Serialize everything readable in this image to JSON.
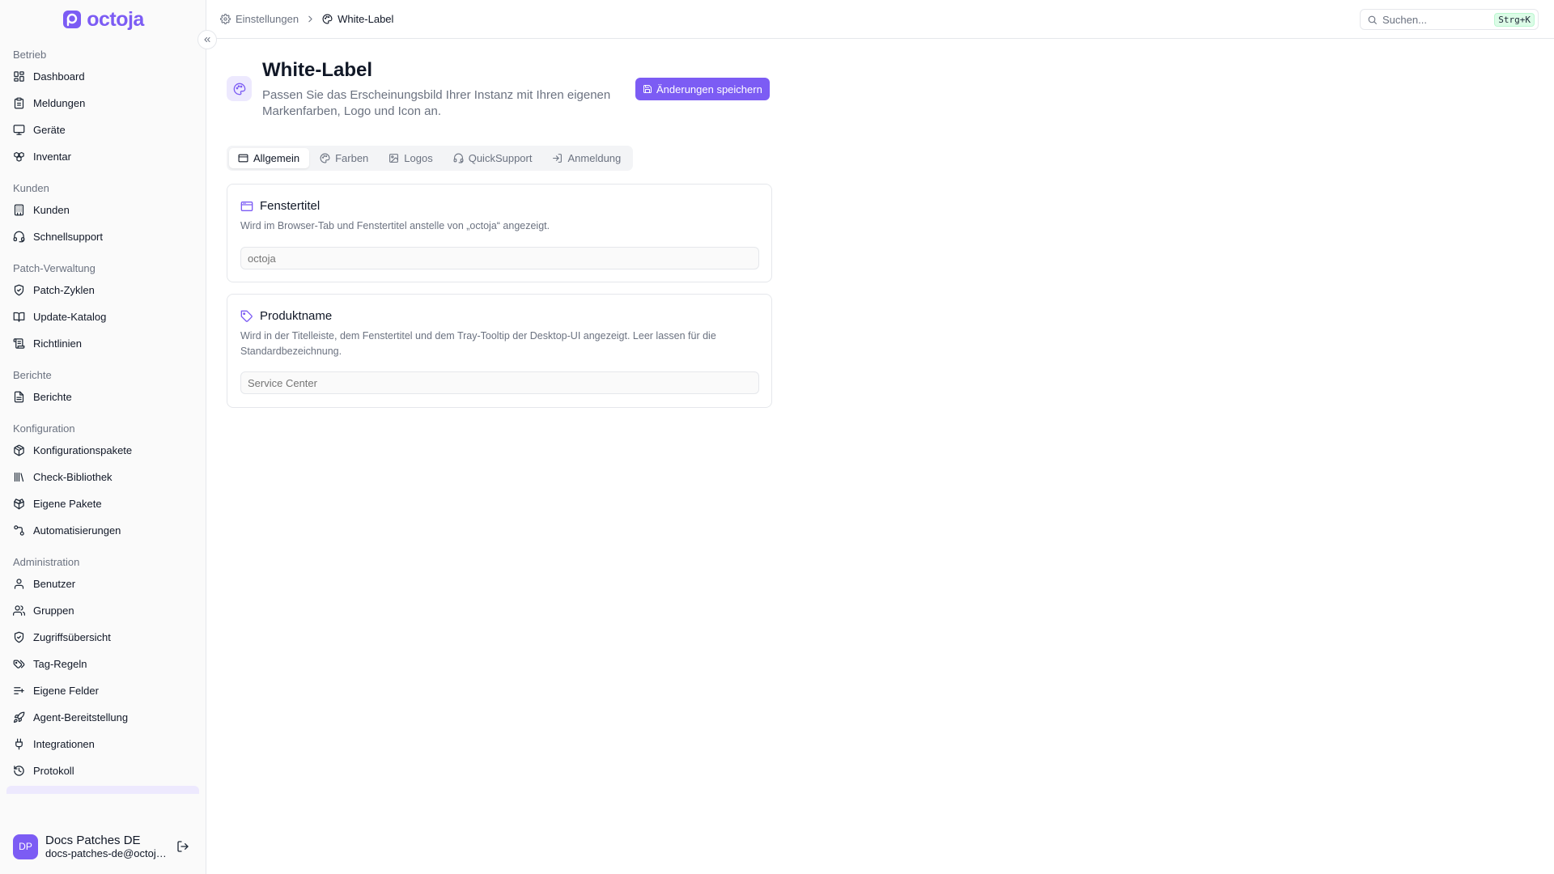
{
  "brand": {
    "name": "octoja",
    "accent": "#7c5cf4"
  },
  "sidebar": {
    "sections": [
      {
        "label": "Betrieb",
        "items": [
          {
            "label": "Dashboard",
            "icon": "dashboard-icon"
          },
          {
            "label": "Meldungen",
            "icon": "clipboard-icon"
          },
          {
            "label": "Geräte",
            "icon": "monitor-icon"
          },
          {
            "label": "Inventar",
            "icon": "boxes-icon"
          }
        ]
      },
      {
        "label": "Kunden",
        "items": [
          {
            "label": "Kunden",
            "icon": "building-icon"
          },
          {
            "label": "Schnellsupport",
            "icon": "headset-icon"
          }
        ]
      },
      {
        "label": "Patch-Verwaltung",
        "items": [
          {
            "label": "Patch-Zyklen",
            "icon": "shield-check-icon"
          },
          {
            "label": "Update-Katalog",
            "icon": "book-icon"
          },
          {
            "label": "Richtlinien",
            "icon": "scroll-icon"
          }
        ]
      },
      {
        "label": "Berichte",
        "items": [
          {
            "label": "Berichte",
            "icon": "file-text-icon"
          }
        ]
      },
      {
        "label": "Konfiguration",
        "items": [
          {
            "label": "Konfigurationspakete",
            "icon": "package-icon"
          },
          {
            "label": "Check-Bibliothek",
            "icon": "library-icon"
          },
          {
            "label": "Eigene Pakete",
            "icon": "package-open-icon"
          },
          {
            "label": "Automatisierungen",
            "icon": "workflow-icon"
          }
        ]
      },
      {
        "label": "Administration",
        "items": [
          {
            "label": "Benutzer",
            "icon": "user-icon"
          },
          {
            "label": "Gruppen",
            "icon": "users-icon"
          },
          {
            "label": "Zugriffsübersicht",
            "icon": "shield-icon"
          },
          {
            "label": "Tag-Regeln",
            "icon": "tags-icon"
          },
          {
            "label": "Eigene Felder",
            "icon": "list-plus-icon"
          },
          {
            "label": "Agent-Bereitstellung",
            "icon": "rocket-icon"
          },
          {
            "label": "Integrationen",
            "icon": "plug-icon"
          },
          {
            "label": "Protokoll",
            "icon": "history-icon"
          }
        ]
      }
    ],
    "user": {
      "initials": "DP",
      "name": "Docs Patches DE",
      "email": "docs-patches-de@octoja.de"
    }
  },
  "topbar": {
    "breadcrumb": {
      "parent": "Einstellungen",
      "current": "White-Label"
    },
    "search": {
      "placeholder": "Suchen...",
      "shortcut": "Strg+K"
    }
  },
  "page": {
    "title": "White-Label",
    "description": "Passen Sie das Erscheinungsbild Ihrer Instanz mit Ihren eigenen Markenfarben, Logo und Icon an.",
    "save_label": "Änderungen speichern",
    "tabs": [
      {
        "label": "Allgemein",
        "icon": "app-window-icon",
        "active": true
      },
      {
        "label": "Farben",
        "icon": "palette-icon",
        "active": false
      },
      {
        "label": "Logos",
        "icon": "image-icon",
        "active": false
      },
      {
        "label": "QuickSupport",
        "icon": "headset-icon",
        "active": false
      },
      {
        "label": "Anmeldung",
        "icon": "log-in-icon",
        "active": false
      }
    ],
    "cards": {
      "window_title": {
        "title": "Fenstertitel",
        "description": "Wird im Browser-Tab und Fenstertitel anstelle von „octoja“ angezeigt.",
        "placeholder": "octoja"
      },
      "product_name": {
        "title": "Produktname",
        "description": "Wird in der Titelleiste, dem Fenstertitel und dem Tray-Tooltip der Desktop-UI angezeigt. Leer lassen für die Standardbezeichnung.",
        "placeholder": "Service Center"
      }
    }
  }
}
